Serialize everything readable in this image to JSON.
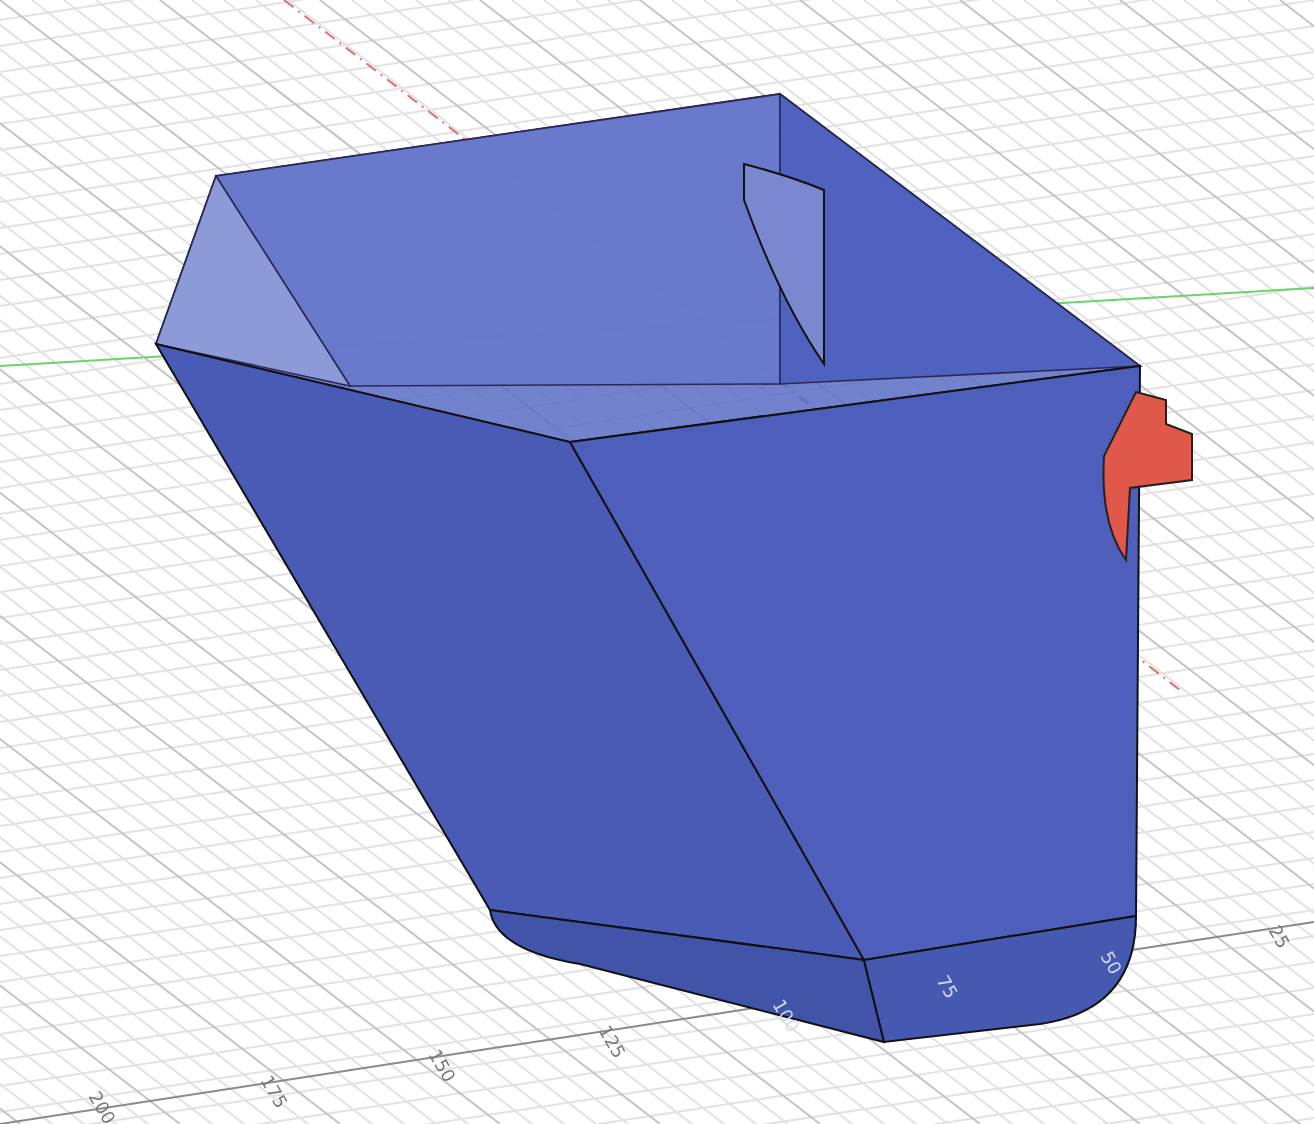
{
  "viewport": {
    "axis_labels": [
      "200",
      "175",
      "150",
      "125",
      "100",
      "75",
      "50",
      "25"
    ]
  }
}
